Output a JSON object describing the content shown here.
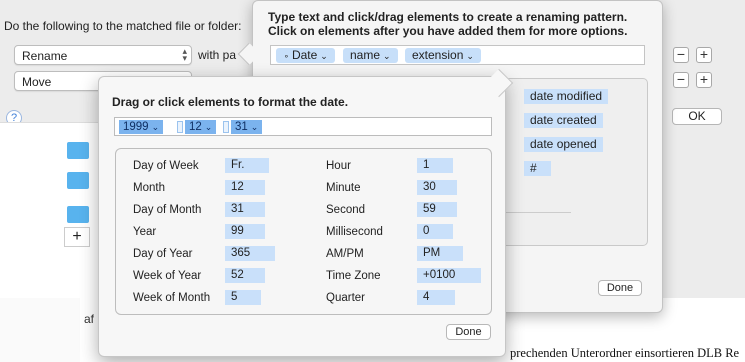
{
  "background": {
    "doc_fragment_left": "af",
    "doc_fragment_bottom": "prechenden Unterordner einsortieren DLB Re"
  },
  "rules": {
    "title": "Do the following to the matched file or folder:",
    "action1": "Rename",
    "with_pattern_text": "with pa",
    "action2": "Move",
    "ok_label": "OK",
    "help_label": "?",
    "minus": "−",
    "plus": "+",
    "add": "+"
  },
  "rename_popover": {
    "instructions_line1": "Type text and click/drag elements to create a renaming pattern.",
    "instructions_line2": "Click on elements after you have added them for more options.",
    "pattern_tokens": [
      "Date",
      "name",
      "extension"
    ],
    "elements": [
      "date modified",
      "date created",
      "date opened",
      "#"
    ],
    "done_label": "Done"
  },
  "date_popover": {
    "title": "Drag or click elements to format the date.",
    "format_tokens": [
      "1999",
      "12",
      "31"
    ],
    "separator": "-",
    "left_rows": [
      {
        "label": "Day of Week",
        "value": "Fr."
      },
      {
        "label": "Month",
        "value": "12"
      },
      {
        "label": "Day of Month",
        "value": "31"
      },
      {
        "label": "Year",
        "value": "99"
      },
      {
        "label": "Day of Year",
        "value": "365"
      },
      {
        "label": "Week of Year",
        "value": "52"
      },
      {
        "label": "Week of Month",
        "value": "5"
      }
    ],
    "right_rows": [
      {
        "label": "Hour",
        "value": "1"
      },
      {
        "label": "Minute",
        "value": "30"
      },
      {
        "label": "Second",
        "value": "59"
      },
      {
        "label": "Millisecond",
        "value": "0"
      },
      {
        "label": "AM/PM",
        "value": "PM"
      },
      {
        "label": "Time Zone",
        "value": "+0100"
      },
      {
        "label": "Quarter",
        "value": "4"
      }
    ],
    "done_label": "Done"
  }
}
